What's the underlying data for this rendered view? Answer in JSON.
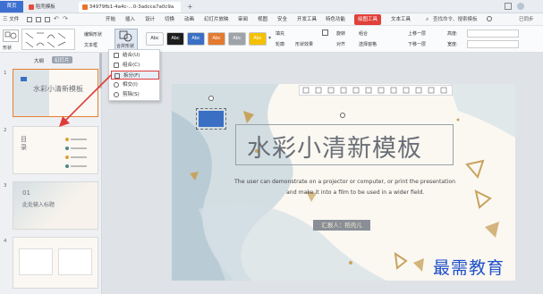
{
  "tabs": [
    {
      "label": "首页"
    },
    {
      "label": "稻壳模板"
    },
    {
      "label": "34979fb1-4a4c-...0-3adcca7a0c9a"
    }
  ],
  "menu": [
    "三 文件",
    "开始",
    "插入",
    "设计",
    "切换",
    "动画",
    "幻灯片放映",
    "审阅",
    "视图",
    "安全",
    "开发工具",
    "特色功能",
    "绘图工具",
    "文本工具"
  ],
  "search_label": "查找命令、搜索模板",
  "share_label": "已同步",
  "ribbon": {
    "shape_label": "形状",
    "edit_shape": "编辑形状",
    "textbox": "文本框",
    "combine_shape": "合并形状",
    "styles": [
      "Abc",
      "Abc",
      "Abc",
      "Abc",
      "Abc",
      "Abc"
    ],
    "style_colors": [
      "#ffffff",
      "#1d1d1d",
      "#3a6fc4",
      "#e47a2e",
      "#9ea3aa",
      "#f5c000"
    ],
    "fill": "填充",
    "outline": "轮廓",
    "shape_effect": "形状效果",
    "align": "对齐",
    "rotate": "旋转",
    "group": "组合",
    "select_pane": "选择窗格",
    "up_layer": "上移一层",
    "down_layer": "下移一层",
    "height_label": "高度:",
    "width_label": "宽度:"
  },
  "dropdown": {
    "items": [
      "结合(U)",
      "组合(C)",
      "拆分(F)",
      "相交(I)",
      "剪除(S)"
    ],
    "highlighted": "拆分(F)"
  },
  "panel": {
    "tab_outline": "大纲",
    "tab_slides": "幻灯片",
    "slide_numbers": [
      "1",
      "2",
      "3",
      "4"
    ],
    "thumb1_title": "水彩小清新模板",
    "thumb2_title": "目 录",
    "thumb3_number": "01",
    "thumb3_title": "此处输入标题"
  },
  "slide": {
    "title": "水彩小清新模板",
    "body_line1": "The user can demonstrate on a projector or computer, or print the presentation",
    "body_line2": "and make it into a film to be used in a wider field.",
    "presenter": "汇报人：稻壳儿"
  },
  "watermark": "最需教育",
  "colors": {
    "accent_red": "#e03b3b",
    "shape_blue": "#3a6fc4",
    "presenter_bg": "#8a8f97",
    "title_color": "#6b6f77",
    "watercolor_blue": "#b8ccd6",
    "gold": "#c9a35e",
    "watermark_blue": "#1f4fc9"
  }
}
